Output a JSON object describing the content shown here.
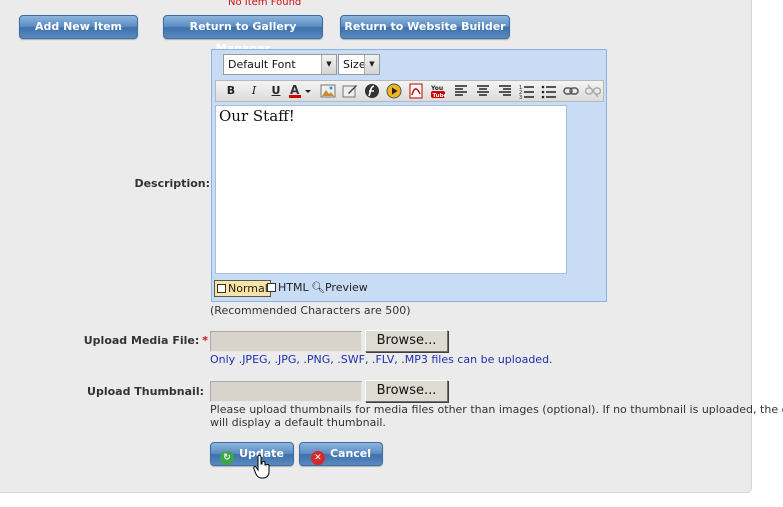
{
  "notice": "No Item Found",
  "top_buttons": {
    "add_new": "Add New Item",
    "gallery": "Return to Gallery Manager",
    "website": "Return to Website Builder"
  },
  "description": {
    "label": "Description:",
    "font_select": "Default Font",
    "size_select": "Size",
    "toolbar_icons": [
      "bold-icon",
      "italic-icon",
      "underline-icon",
      "font-color-icon",
      "insert-image-icon",
      "edit-image-icon",
      "flash-icon",
      "media-icon",
      "pdf-icon",
      "youtube-icon",
      "align-left-icon",
      "align-center-icon",
      "align-right-icon",
      "ordered-list-icon",
      "unordered-list-icon",
      "link-icon",
      "unlink-icon"
    ],
    "text": "Our Staff!",
    "modes": {
      "normal": "Normal",
      "html": "HTML",
      "preview": "Preview"
    },
    "recommendation": "(Recommended Characters are 500)"
  },
  "media": {
    "label": "Upload Media File:",
    "required_mark": "*",
    "browse": "Browse...",
    "hint": "Only .JPEG, .JPG, .PNG, .SWF, .FLV, .MP3 files can be uploaded."
  },
  "thumbnail": {
    "label": "Upload Thumbnail:",
    "browse": "Browse...",
    "hint_line1": "Please upload thumbnails for media files other than images (optional). If no thumbnail is uploaded, the gallery",
    "hint_line2": "will display a default thumbnail."
  },
  "actions": {
    "update": "Update",
    "cancel": "Cancel"
  },
  "colors": {
    "button_blue": "#5b8cc4",
    "required_red": "#cc1111",
    "hint_blue": "#1e2fb0",
    "editor_bg": "#c8dcf6"
  }
}
